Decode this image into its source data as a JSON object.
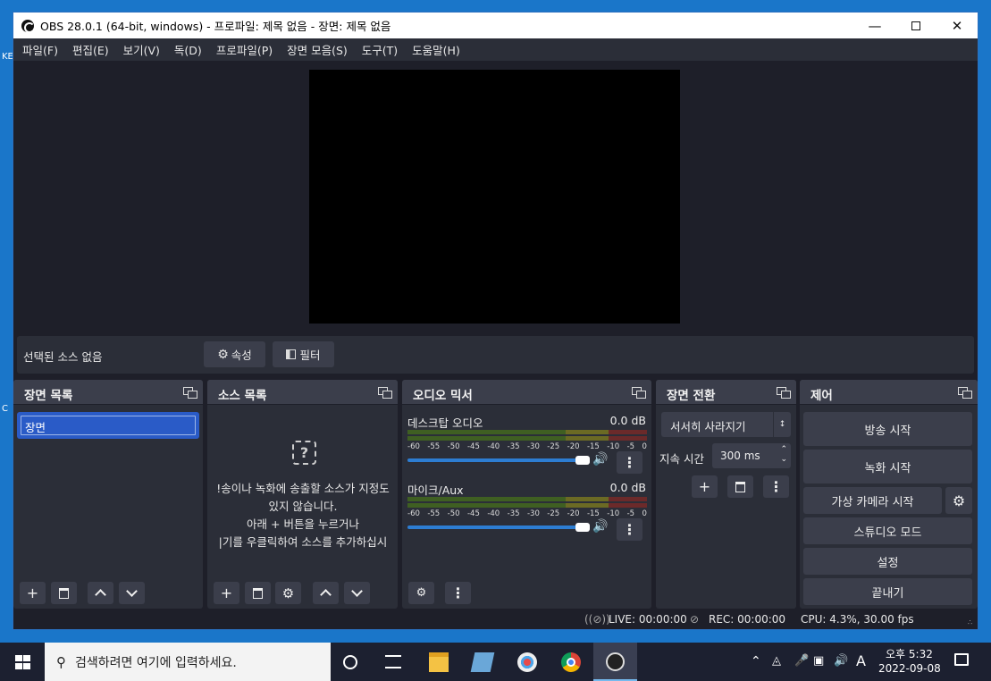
{
  "window": {
    "title": "OBS 28.0.1 (64-bit, windows) - 프로파일: 제목 없음 - 장면: 제목 없음"
  },
  "desktop": {
    "glyph_left_1": "KE",
    "glyph_left_2": "C"
  },
  "menu": [
    "파일(F)",
    "편집(E)",
    "보기(V)",
    "독(D)",
    "프로파일(P)",
    "장면 모음(S)",
    "도구(T)",
    "도움말(H)"
  ],
  "source_toolbar": {
    "label": "선택된 소스 없음",
    "properties": "속성",
    "filters": "필터"
  },
  "docks": {
    "scenes": {
      "title": "장면 목록",
      "items": [
        "장면"
      ]
    },
    "sources": {
      "title": "소스 목록",
      "empty_lines": [
        "!송이나 녹화에 송출할 소스가 지정도",
        "있지 않습니다.",
        "아래 + 버튼을 누르거나",
        "|기를 우클릭하여 소스를 추가하십시"
      ]
    },
    "mixer": {
      "title": "오디오 믹서",
      "channels": [
        {
          "name": "데스크탑 오디오",
          "level": "0.0 dB",
          "volume": 1.0
        },
        {
          "name": "마이크/Aux",
          "level": "0.0 dB",
          "volume": 1.0
        }
      ],
      "ticks": [
        "-60",
        "-55",
        "-50",
        "-45",
        "-40",
        "-35",
        "-30",
        "-25",
        "-20",
        "-15",
        "-10",
        "-5",
        "0"
      ]
    },
    "transitions": {
      "title": "장면 전환",
      "selected": "서서히 사라지기",
      "duration_label": "지속 시간",
      "duration_value": "300 ms"
    },
    "controls": {
      "title": "제어",
      "buttons": [
        "방송 시작",
        "녹화 시작",
        "가상 카메라 시작",
        "스튜디오 모드",
        "설정",
        "끝내기"
      ]
    }
  },
  "status": {
    "live": "LIVE: 00:00:00",
    "rec": "REC: 00:00:00",
    "cpu": "CPU: 4.3%, 30.00 fps"
  },
  "taskbar": {
    "search_placeholder": "검색하려면 여기에 입력하세요.",
    "ampm": "오후 5:32",
    "date": "2022-09-08",
    "ime": "A"
  },
  "colors": {
    "desktop": "#1a76c9",
    "window_bg": "#1e1f29",
    "dock_bg": "#2b2e38",
    "button_bg": "#3b3e4b",
    "selection": "#2a5bc7",
    "volume": "#2d7dd2"
  }
}
